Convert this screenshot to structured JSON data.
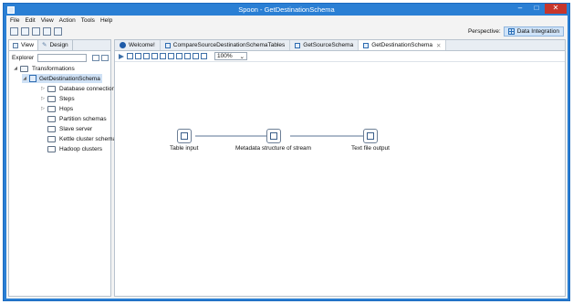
{
  "window": {
    "title": "Spoon - GetDestinationSchema",
    "min": "‒",
    "max": "□",
    "close": "✕"
  },
  "menu": [
    "File",
    "Edit",
    "View",
    "Action",
    "Tools",
    "Help"
  ],
  "perspective": {
    "label": "Perspective:",
    "value": "Data Integration"
  },
  "left_tabs": [
    {
      "label": "View"
    },
    {
      "label": "Design"
    }
  ],
  "explorer": {
    "label": "Explorer"
  },
  "tree": {
    "root": "Transformations",
    "transformation": "GetDestinationSchema",
    "children": [
      "Database connections",
      "Steps",
      "Hops",
      "Partition schemas",
      "Slave server",
      "Kettle cluster schemas",
      "Hadoop clusters"
    ]
  },
  "editor_tabs": [
    {
      "label": "Welcome!"
    },
    {
      "label": "CompareSourceDestinationSchemaTables"
    },
    {
      "label": "GetSourceSchema"
    },
    {
      "label": "GetDestinationSchema"
    }
  ],
  "zoom": {
    "value": "100%"
  },
  "steps": [
    {
      "label": "Table input"
    },
    {
      "label": "Metadata structure of stream"
    },
    {
      "label": "Text file output"
    }
  ]
}
